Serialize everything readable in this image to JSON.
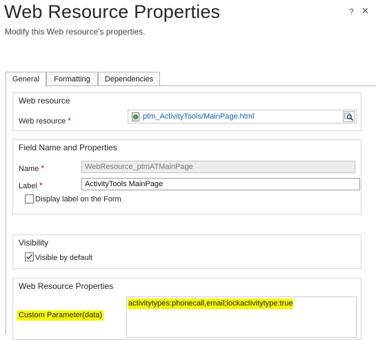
{
  "dialog": {
    "title": "Web Resource Properties",
    "subtitle": "Modify this Web resource's properties.",
    "help_label": "?",
    "close_label": "✕"
  },
  "tabs": [
    {
      "label": "General",
      "active": true
    },
    {
      "label": "Formatting",
      "active": false
    },
    {
      "label": "Dependencies",
      "active": false
    }
  ],
  "web_resource_section": {
    "title": "Web resource",
    "label": "Web resource",
    "required_mark": "*",
    "value": "ptm_ActivityTools/MainPage.html",
    "icon": "web-page-icon",
    "lookup_icon": "lookup-search-icon"
  },
  "field_section": {
    "title": "Field Name and Properties",
    "name_label": "Name",
    "name_value": "WebResource_ptmATMainPage",
    "label_label": "Label",
    "label_value": "ActivityTools MainPage",
    "required_mark": "*",
    "display_label_checkbox": {
      "label": "Display label on the Form",
      "checked": false
    }
  },
  "visibility_section": {
    "title": "Visibility",
    "visible_checkbox": {
      "label": "Visible by default",
      "checked": true
    }
  },
  "properties_section": {
    "title": "Web Resource Properties",
    "custom_param_label": "Custom Parameter(data)",
    "custom_param_value": "activitytypes:phonecall,email;lockactivitytype:true",
    "highlight_color": "#f6f600"
  },
  "colors": {
    "link": "#1160b7",
    "required": "#d00000",
    "border": "#b5b5b5"
  }
}
